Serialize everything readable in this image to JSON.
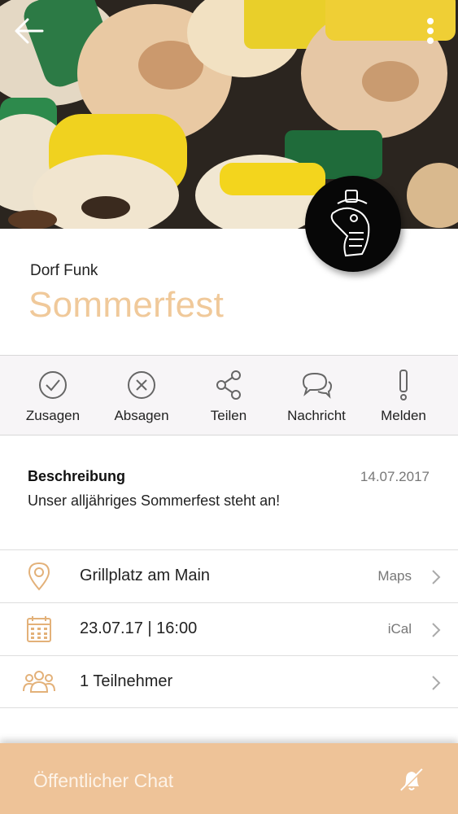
{
  "header": {
    "organizer": "Dorf Funk",
    "title": "Sommerfest"
  },
  "actions": [
    {
      "label": "Zusagen",
      "icon": "check-circle-icon"
    },
    {
      "label": "Absagen",
      "icon": "x-circle-icon"
    },
    {
      "label": "Teilen",
      "icon": "share-icon"
    },
    {
      "label": "Nachricht",
      "icon": "chat-bubbles-icon"
    },
    {
      "label": "Melden",
      "icon": "exclamation-icon"
    }
  ],
  "description": {
    "heading": "Beschreibung",
    "date": "14.07.2017",
    "text": "Unser alljähriges Sommerfest steht an!"
  },
  "details": [
    {
      "text": "Grillplatz am Main",
      "side": "Maps",
      "icon": "location-pin-icon"
    },
    {
      "text": "23.07.17 | 16:00",
      "side": "iCal",
      "icon": "calendar-icon"
    },
    {
      "text": "1 Teilnehmer",
      "side": "",
      "icon": "group-icon"
    }
  ],
  "bottom_bar": {
    "label": "Öffentlicher Chat",
    "icon": "bell-muted-icon"
  },
  "colors": {
    "accent": "#eec398",
    "title": "#f0c99a",
    "icon": "#e3b179"
  }
}
